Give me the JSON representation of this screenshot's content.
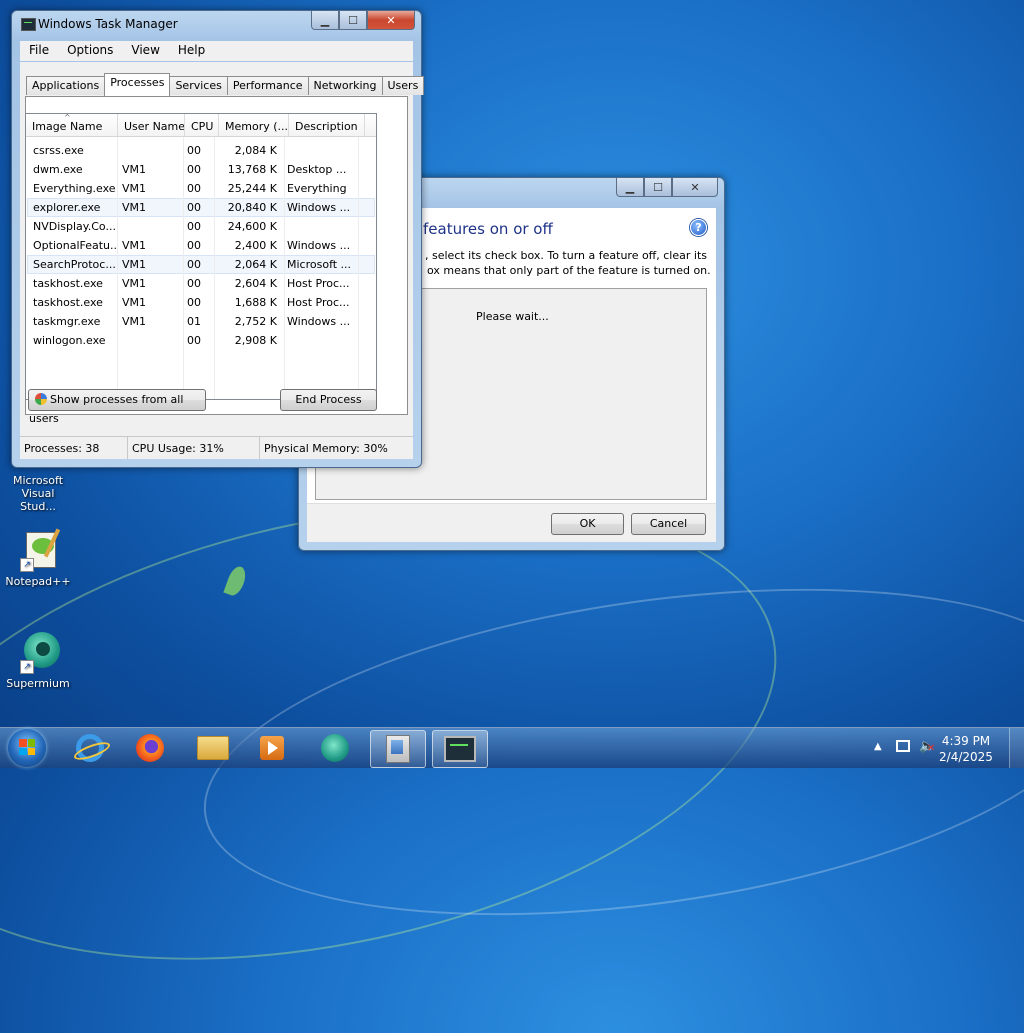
{
  "desktop": {
    "icons": [
      {
        "label": "Microsoft Visual Stud..."
      },
      {
        "label": "Notepad++"
      },
      {
        "label": "Supermium"
      }
    ]
  },
  "task_manager": {
    "title": "Windows Task Manager",
    "menu": [
      "File",
      "Options",
      "View",
      "Help"
    ],
    "tabs": [
      "Applications",
      "Processes",
      "Services",
      "Performance",
      "Networking",
      "Users"
    ],
    "active_tab": "Processes",
    "columns": [
      "Image Name",
      "User Name",
      "CPU",
      "Memory (...",
      "Description"
    ],
    "rows": [
      {
        "image": "csrss.exe",
        "user": "",
        "cpu": "00",
        "mem": "2,084 K",
        "desc": ""
      },
      {
        "image": "dwm.exe",
        "user": "VM1",
        "cpu": "00",
        "mem": "13,768 K",
        "desc": "Desktop ..."
      },
      {
        "image": "Everything.exe",
        "user": "VM1",
        "cpu": "00",
        "mem": "25,244 K",
        "desc": "Everything"
      },
      {
        "image": "explorer.exe",
        "user": "VM1",
        "cpu": "00",
        "mem": "20,840 K",
        "desc": "Windows ..."
      },
      {
        "image": "NVDisplay.Co...",
        "user": "",
        "cpu": "00",
        "mem": "24,600 K",
        "desc": ""
      },
      {
        "image": "OptionalFeatu...",
        "user": "VM1",
        "cpu": "00",
        "mem": "2,400 K",
        "desc": "Windows ..."
      },
      {
        "image": "SearchProtoc...",
        "user": "VM1",
        "cpu": "00",
        "mem": "2,064 K",
        "desc": "Microsoft ..."
      },
      {
        "image": "taskhost.exe",
        "user": "VM1",
        "cpu": "00",
        "mem": "2,604 K",
        "desc": "Host Proc..."
      },
      {
        "image": "taskhost.exe",
        "user": "VM1",
        "cpu": "00",
        "mem": "1,688 K",
        "desc": "Host Proc..."
      },
      {
        "image": "taskmgr.exe",
        "user": "VM1",
        "cpu": "01",
        "mem": "2,752 K",
        "desc": "Windows ..."
      },
      {
        "image": "winlogon.exe",
        "user": "",
        "cpu": "00",
        "mem": "2,908 K",
        "desc": ""
      }
    ],
    "show_all_button": "Show processes from all users",
    "end_process_button": "End Process",
    "status": {
      "processes": "Processes: 38",
      "cpu": "CPU Usage: 31%",
      "memory": "Physical Memory: 30%"
    }
  },
  "features_dialog": {
    "heading": "features on or off",
    "description_line1": ", select its check box. To turn a feature off, clear its",
    "description_line2": "ox means that only part of the feature is turned on.",
    "loading_text": "Please wait...",
    "ok_button": "OK",
    "cancel_button": "Cancel"
  },
  "taskbar": {
    "clock_time": "4:39 PM",
    "clock_date": "2/4/2025"
  }
}
